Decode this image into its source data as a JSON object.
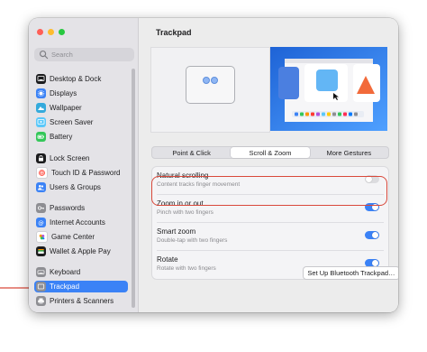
{
  "window": {
    "title": "Trackpad"
  },
  "sidebar": {
    "search_placeholder": "Search",
    "items": [
      {
        "label": "Desktop & Dock",
        "icon": "desktop-dock-icon",
        "color": "#1c1c1e"
      },
      {
        "label": "Displays",
        "icon": "displays-icon",
        "color": "#3b82f6"
      },
      {
        "label": "Wallpaper",
        "icon": "wallpaper-icon",
        "color": "#34aadc"
      },
      {
        "label": "Screen Saver",
        "icon": "screen-saver-icon",
        "color": "#5ac8fa"
      },
      {
        "label": "Battery",
        "icon": "battery-icon",
        "color": "#34c759"
      },
      {
        "label": "Lock Screen",
        "icon": "lock-screen-icon",
        "color": "#1c1c1e"
      },
      {
        "label": "Touch ID & Password",
        "icon": "touch-id-icon",
        "color": "#ff3b30"
      },
      {
        "label": "Users & Groups",
        "icon": "users-groups-icon",
        "color": "#3b82f6"
      },
      {
        "label": "Passwords",
        "icon": "passwords-icon",
        "color": "#8e8e93"
      },
      {
        "label": "Internet Accounts",
        "icon": "internet-accounts-icon",
        "color": "#3b82f6"
      },
      {
        "label": "Game Center",
        "icon": "game-center-icon",
        "color": "#ffffff"
      },
      {
        "label": "Wallet & Apple Pay",
        "icon": "wallet-icon",
        "color": "#1c1c1e"
      },
      {
        "label": "Keyboard",
        "icon": "keyboard-icon",
        "color": "#8e8e93"
      },
      {
        "label": "Trackpad",
        "icon": "trackpad-icon",
        "color": "#8e8e93",
        "selected": true
      },
      {
        "label": "Printers & Scanners",
        "icon": "printer-icon",
        "color": "#8e8e93"
      }
    ]
  },
  "tabs": [
    {
      "label": "Point & Click"
    },
    {
      "label": "Scroll & Zoom",
      "selected": true
    },
    {
      "label": "More Gestures"
    }
  ],
  "settings": [
    {
      "title": "Natural scrolling",
      "subtitle": "Content tracks finger movement",
      "on": false
    },
    {
      "title": "Zoom in or out",
      "subtitle": "Pinch with two fingers",
      "on": true
    },
    {
      "title": "Smart zoom",
      "subtitle": "Double-tap with two fingers",
      "on": true
    },
    {
      "title": "Rotate",
      "subtitle": "Rotate with two fingers",
      "on": true
    }
  ],
  "buttons": {
    "bluetooth": "Set Up Bluetooth Trackpad…",
    "help": "?"
  },
  "colors": {
    "accent": "#3b82f6",
    "highlight": "#d9493b",
    "arrow": "#d9493b"
  }
}
